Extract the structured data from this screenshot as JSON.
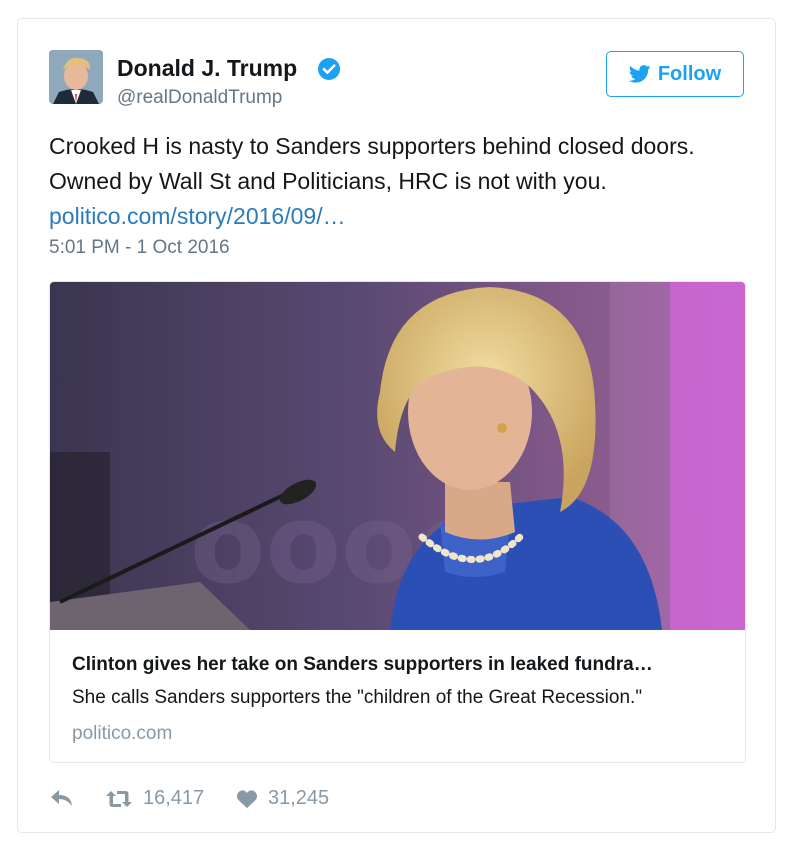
{
  "tweet": {
    "author_name": "Donald J. Trump",
    "author_handle": "@realDonaldTrump",
    "text_line1": "Crooked H is nasty to Sanders supporters behind closed doors.",
    "text_line2": "Owned by Wall St and Politicians, HRC is not with you.",
    "link_text": "politico.com/story/2016/09/…",
    "timestamp": "5:01 PM - 1 Oct 2016"
  },
  "follow_button": {
    "label": "Follow",
    "icon": "twitter-bird-icon"
  },
  "card": {
    "title": "Clinton gives her take on Sanders supporters in leaked fundra…",
    "description": "She calls Sanders supporters the \"children of the Great Recession.\"",
    "domain": "politico.com"
  },
  "actions": {
    "retweets": "16,417",
    "likes": "31,245"
  },
  "colors": {
    "accent": "#1da1f2",
    "link": "#2b7bb9",
    "muted": "#657786",
    "border": "#e1e8ed"
  },
  "icons": [
    "verified-badge-icon",
    "twitter-bird-icon",
    "reply-icon",
    "retweet-icon",
    "heart-icon"
  ]
}
